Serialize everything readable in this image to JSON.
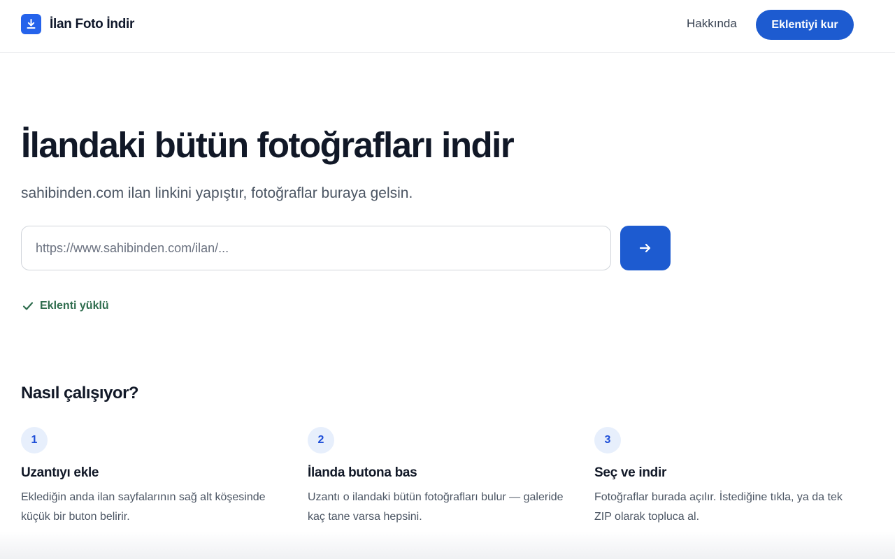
{
  "header": {
    "brand_name": "İlan Foto İndir",
    "brand_icon": "download-icon",
    "nav_about": "Hakkında",
    "install_button": "Eklentiyi kur"
  },
  "hero": {
    "title": "İlandaki bütün fotoğrafları indir",
    "subtitle": "sahibinden.com ilan linkini yapıştır, fotoğraflar buraya gelsin.",
    "url_input": {
      "value": "",
      "placeholder": "https://www.sahibinden.com/ilan/..."
    },
    "submit_icon": "arrow-right-icon",
    "status": {
      "icon": "check-icon",
      "text": "Eklenti yüklü"
    }
  },
  "how_it_works": {
    "title": "Nasıl çalışıyor?",
    "steps": [
      {
        "number": "1",
        "title": "Uzantıyı ekle",
        "description": "Eklediğin anda ilan sayfalarının sağ alt köşesinde küçük bir buton belirir."
      },
      {
        "number": "2",
        "title": "İlanda butona bas",
        "description": "Uzantı o ilandaki bütün fotoğrafları bulur — galeride kaç tane varsa hepsini."
      },
      {
        "number": "3",
        "title": "Seç ve indir",
        "description": "Fotoğraflar burada açılır. İstediğine tıkla, ya da tek ZIP olarak topluca al."
      }
    ]
  },
  "colors": {
    "accent": "#1d5bd0",
    "status_green": "#2f6d4e",
    "step_badge_bg": "#e7effc"
  }
}
